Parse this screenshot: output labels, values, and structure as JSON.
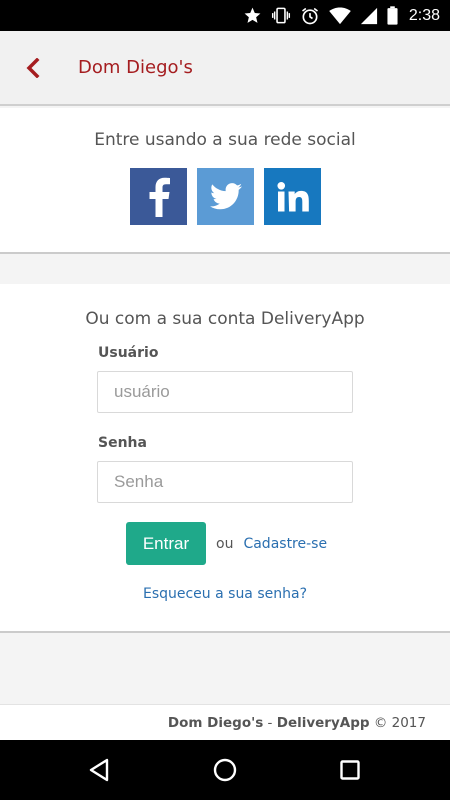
{
  "status_bar": {
    "time": "2:38",
    "icons": [
      "star-icon",
      "vibrate-icon",
      "alarm-icon",
      "wifi-icon",
      "signal-icon",
      "battery-icon"
    ]
  },
  "app_bar": {
    "title": "Dom Diego's",
    "back_icon": "chevron-left-icon",
    "color": "#a51d20"
  },
  "social": {
    "heading": "Entre usando a sua rede social",
    "buttons": [
      {
        "name": "facebook",
        "glyph": "f",
        "color": "#3b5998"
      },
      {
        "name": "twitter",
        "glyph": "bird",
        "color": "#5b9bd5"
      },
      {
        "name": "linkedin",
        "glyph": "in",
        "color": "#1778bf"
      }
    ]
  },
  "login": {
    "heading": "Ou com a sua conta DeliveryApp",
    "username_label": "Usuário",
    "username_placeholder": "usuário",
    "username_value": "",
    "password_label": "Senha",
    "password_placeholder": "Senha",
    "password_value": "",
    "submit_label": "Entrar",
    "or_text": "ou",
    "signup_link": "Cadastre-se",
    "forgot_link": "Esqueceu a sua senha?",
    "accent_color": "#1fa98a",
    "link_color": "#2a6fb0"
  },
  "footer": {
    "brand": "Dom Diego's",
    "separator": " - ",
    "app": "DeliveryApp",
    "copyright": " © 2017"
  },
  "nav_bar": {
    "icons": [
      "back-triangle-icon",
      "home-circle-icon",
      "recents-square-icon"
    ]
  }
}
